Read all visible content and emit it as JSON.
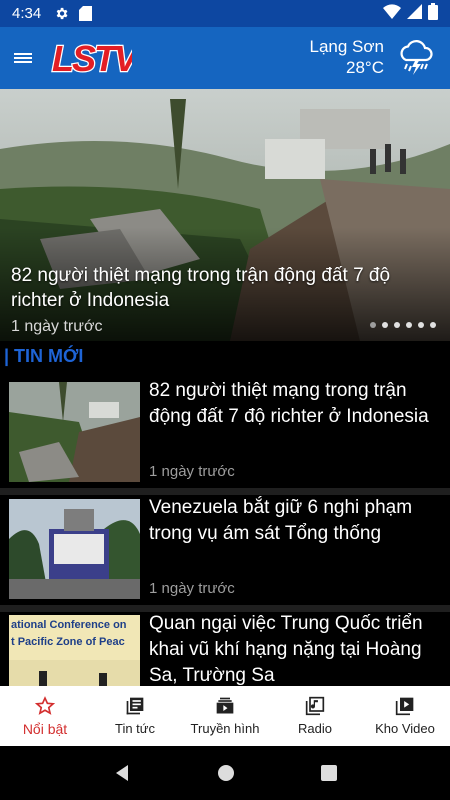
{
  "status_bar": {
    "time": "4:34",
    "icons": [
      "gear-icon",
      "sd-card-icon",
      "wifi-icon",
      "signal-icon",
      "battery-icon"
    ]
  },
  "app_bar": {
    "logo_text": "LSTV",
    "weather_city": "Lạng Sơn",
    "weather_temp": "28°C",
    "weather_icon": "thunderstorm-icon"
  },
  "hero": {
    "title": "82 người thiệt mạng trong trận động đất 7 độ richter ở Indonesia",
    "time": "1 ngày trước",
    "slide_count": 6,
    "active_slide": 1
  },
  "section": {
    "label": "| TIN MỚI",
    "accent": "#1e64d6"
  },
  "news": [
    {
      "title": "82 người thiệt mạng trong trận động đất 7 độ richter ở Indonesia",
      "time": "1 ngày trước"
    },
    {
      "title": "Venezuela bắt giữ 6 nghi phạm trong vụ ám sát Tổng thống",
      "time": "1 ngày trước"
    },
    {
      "title": "Quan ngại việc Trung Quốc triển khai vũ khí hạng nặng tại Hoàng Sa, Trường Sa",
      "time": "",
      "thumb_text_1": "ational Conference on",
      "thumb_text_2": "t Pacific Zone of Peac"
    }
  ],
  "bottom_nav": {
    "items": [
      {
        "label": "Nổi bật",
        "icon": "star-icon",
        "active": true
      },
      {
        "label": "Tin tức",
        "icon": "newspaper-icon",
        "active": false
      },
      {
        "label": "Truyền hình",
        "icon": "tv-icon",
        "active": false
      },
      {
        "label": "Radio",
        "icon": "radio-icon",
        "active": false
      },
      {
        "label": "Kho Video",
        "icon": "video-library-icon",
        "active": false
      }
    ],
    "active_color": "#d32f2f"
  },
  "colors": {
    "status_bar": "#0d47a1",
    "app_bar": "#1565c0",
    "logo_red": "#e31e24"
  }
}
